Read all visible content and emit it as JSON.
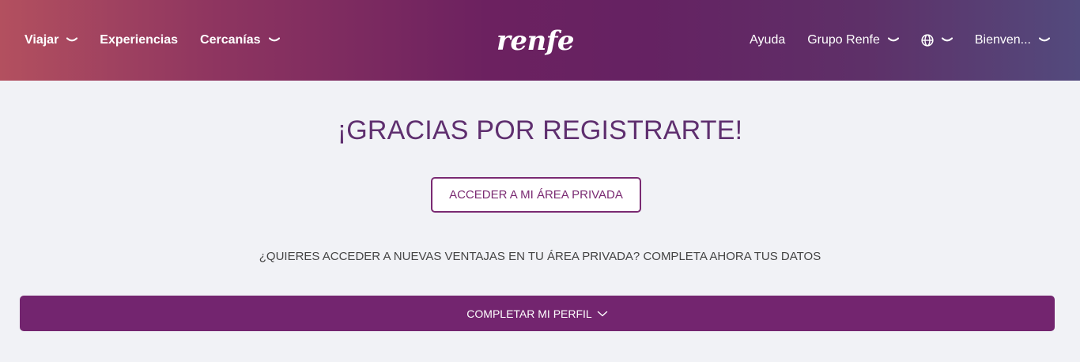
{
  "header": {
    "nav_left": [
      {
        "label": "Viajar",
        "has_dropdown": true
      },
      {
        "label": "Experiencias",
        "has_dropdown": false
      },
      {
        "label": "Cercanías",
        "has_dropdown": true
      }
    ],
    "logo_text": "renfe",
    "nav_right": {
      "help": "Ayuda",
      "group": "Grupo Renfe",
      "language_icon": "globe-icon",
      "user": "Bienven..."
    }
  },
  "main": {
    "title": "¡GRACIAS POR REGISTRARTE!",
    "access_button": "ACCEDER A MI ÁREA PRIVADA",
    "question": "¿QUIERES ACCEDER A NUEVAS VENTAJAS EN TU ÁREA PRIVADA? COMPLETA AHORA TUS DATOS",
    "complete_profile_button": "COMPLETAR MI PERFIL"
  },
  "colors": {
    "primary_purple": "#73256f",
    "title_purple": "#5f2f6f",
    "background": "#f1f2f6",
    "header_gradient_start": "#b3505f",
    "header_gradient_end": "#534a7d"
  }
}
